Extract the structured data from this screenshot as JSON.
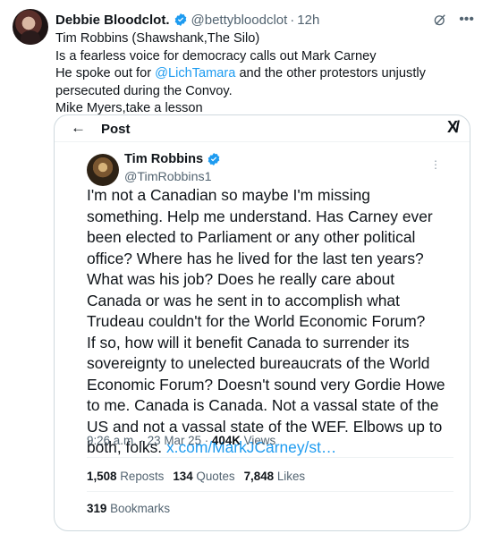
{
  "outer_post": {
    "author_name": "Debbie Bloodclot.",
    "handle": "@bettybloodclot",
    "separator": "·",
    "time": "12h",
    "icons": {
      "grok": "grok-icon",
      "more": "more-icon",
      "verified": "verified-badge-icon"
    },
    "lines": [
      {
        "parts": [
          {
            "text": "Tim Robbins  (Shawshank,The Silo)"
          }
        ]
      },
      {
        "parts": [
          {
            "text": "Is a fearless voice for democracy calls out Mark Carney"
          }
        ]
      },
      {
        "parts": [
          {
            "text": "He spoke out for  "
          },
          {
            "text": "@LichTamara",
            "mention": true
          },
          {
            "text": " and the other protestors unjustly"
          }
        ]
      },
      {
        "parts": [
          {
            "text": "persecuted during the Convoy."
          }
        ]
      },
      {
        "parts": [
          {
            "text": "Mike Myers,take a lesson"
          }
        ]
      }
    ]
  },
  "quoted_card": {
    "header_title": "Post",
    "back_icon": "←",
    "x_logo": "X",
    "author_name": "Tim Robbins",
    "handle": "@TimRobbins1",
    "lines": [
      "I'm not a Canadian so maybe I'm missing",
      "something. Help me understand. Has Carney ever",
      "been elected to Parliament or any other political",
      "office? Where has he lived for the last ten years?",
      "What was his job? Does he really care about",
      "Canada or was he sent in to accomplish what",
      "Trudeau couldn't for the World Economic Forum?",
      "If so, how will it benefit Canada to surrender its",
      "sovereignty to unelected bureaucrats of the World",
      "Economic Forum? Doesn't sound very Gordie Howe",
      "to me. Canada is Canada. Not a vassal state of the",
      "US and not a vassal state of the WEF. Elbows up to"
    ],
    "last_line_text": "both, folks. ",
    "link_text": "x.com/MarkJCarney/st…",
    "timestamp": "9:26 a.m. · 23 Mar 25 · ",
    "views_count": "404K",
    "views_label": " Views",
    "stats": {
      "reposts_count": "1,508",
      "reposts_label": " Reposts",
      "quotes_count": "134",
      "quotes_label": " Quotes",
      "likes_count": "7,848",
      "likes_label": " Likes"
    },
    "bookmarks_count": "319",
    "bookmarks_label": " Bookmarks"
  },
  "colors": {
    "link": "#1d9bf0",
    "verified": "#1d9bf0",
    "secondary_text": "#536471",
    "border": "#cfd9de"
  }
}
